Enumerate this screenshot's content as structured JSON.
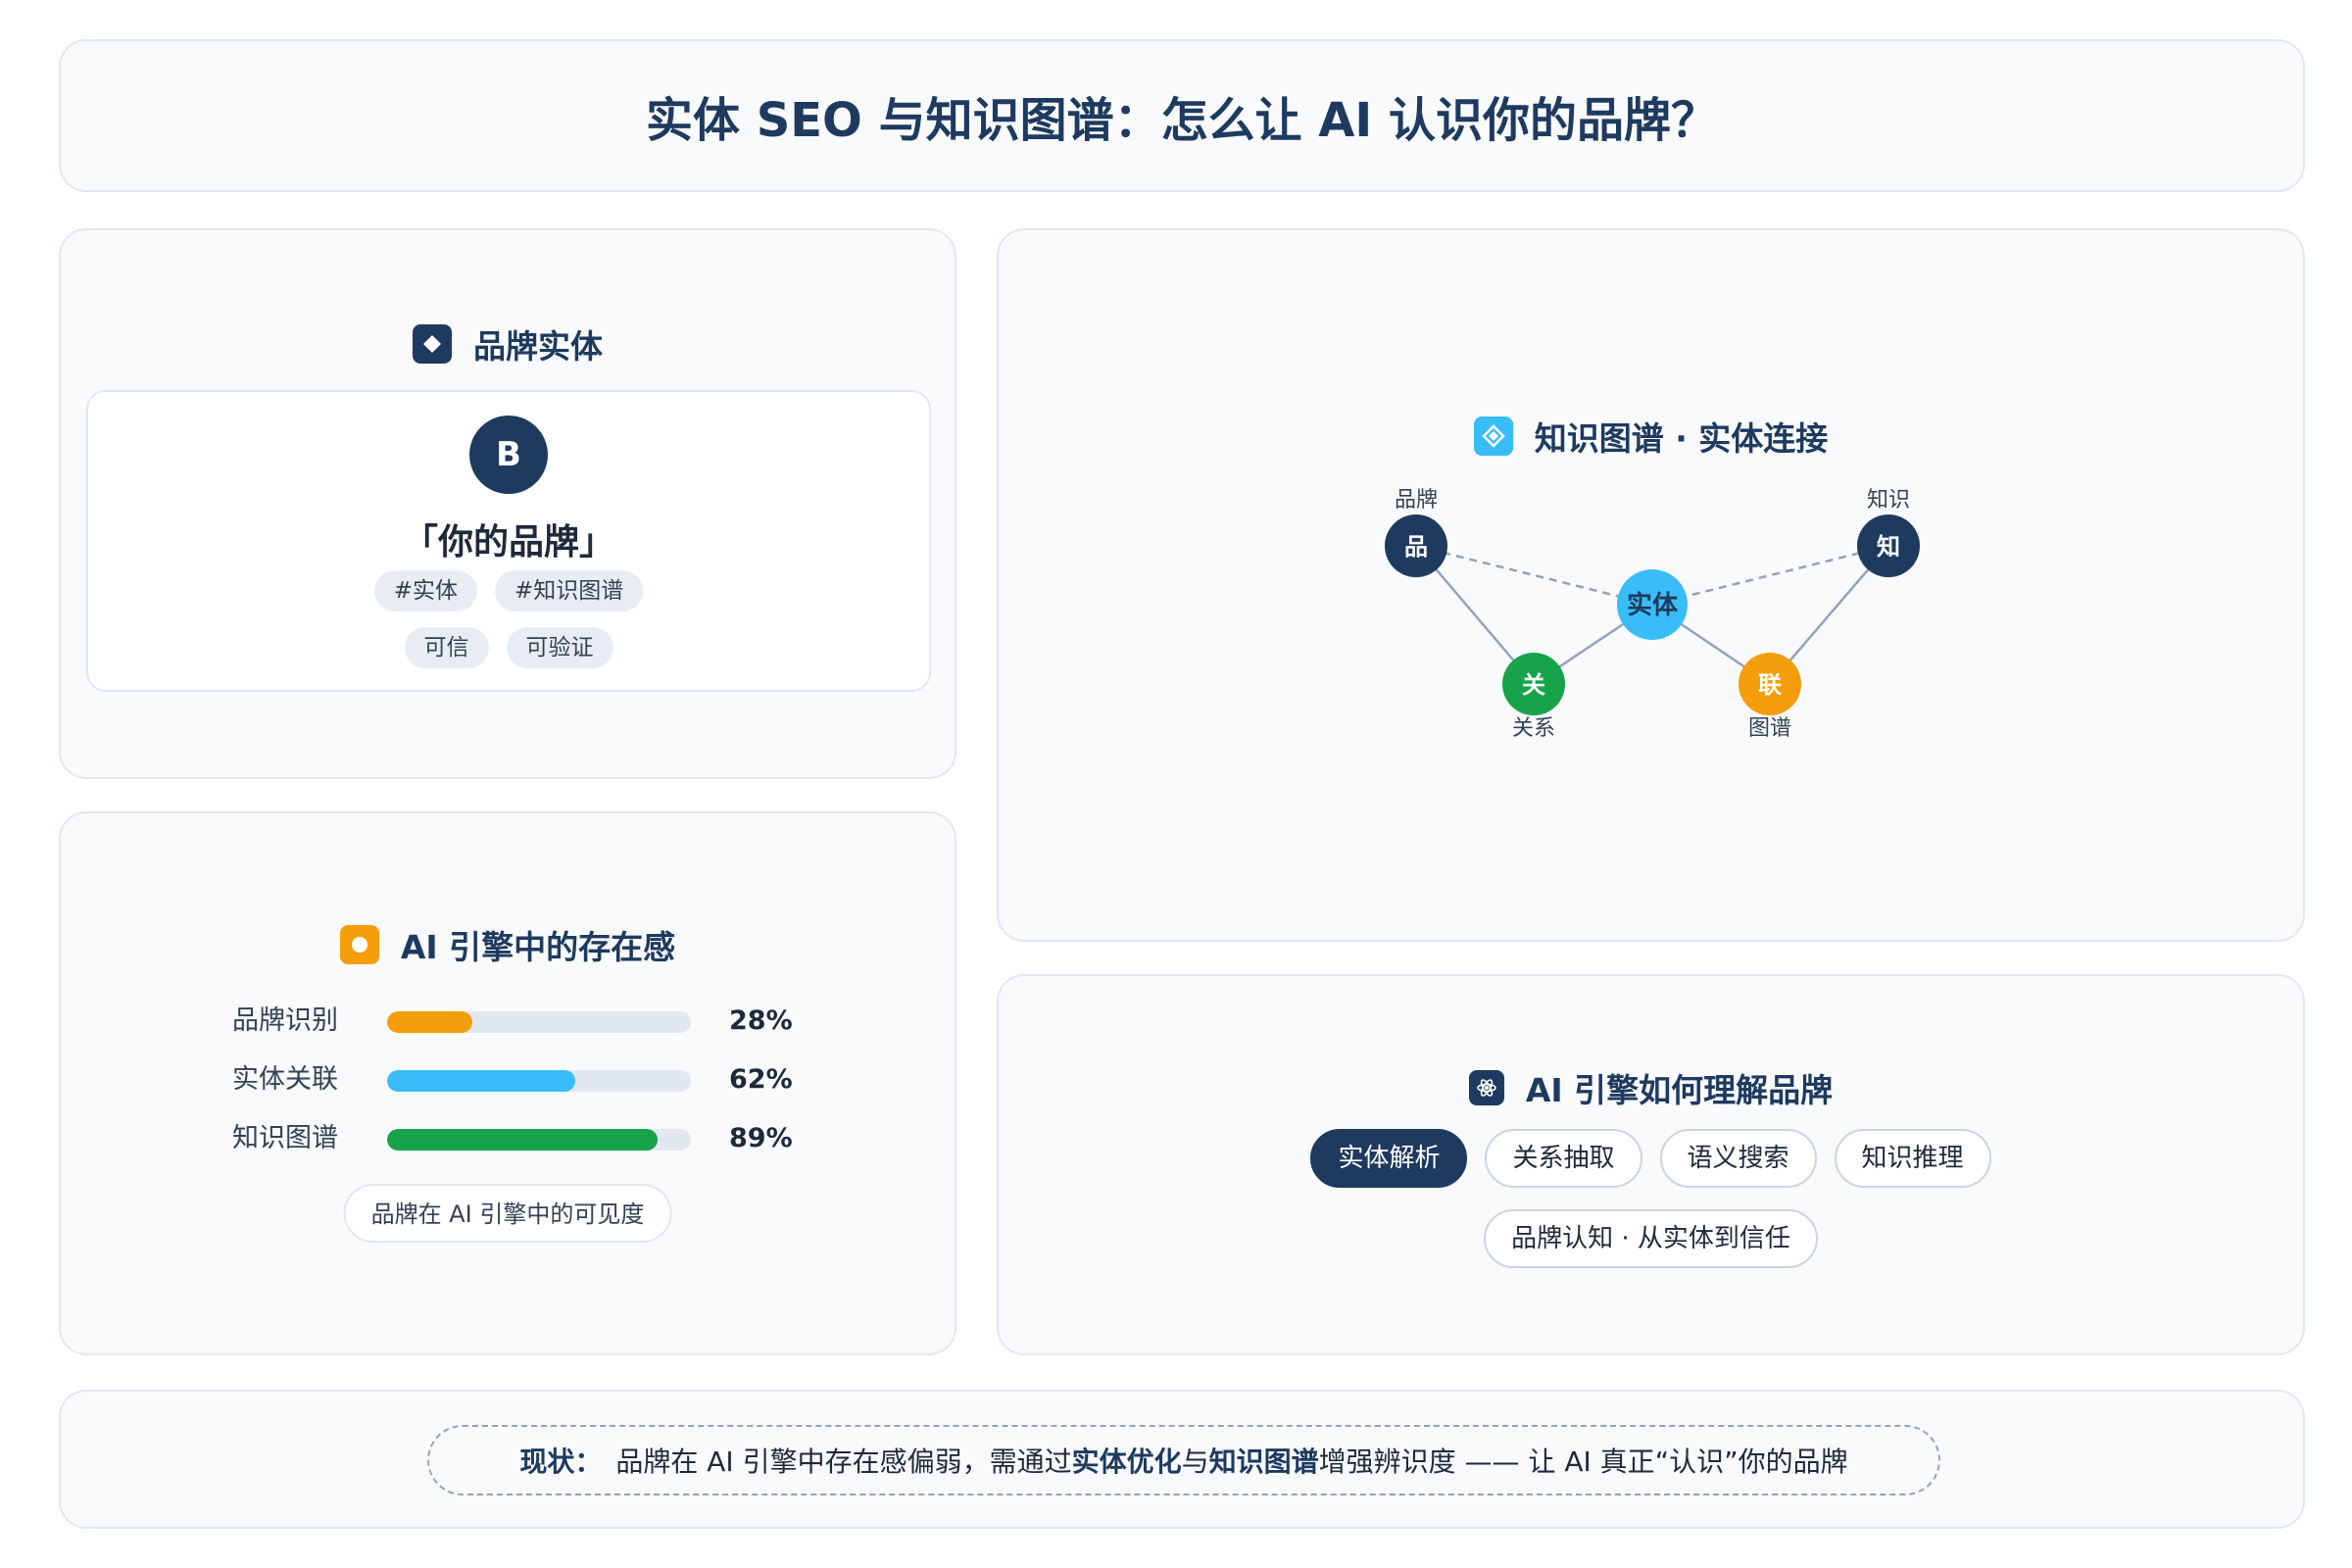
{
  "title": "实体 SEO 与知识图谱：怎么让 AI 认识你的品牌？",
  "colors": {
    "navy": "#1e3a5f",
    "sky": "#38bdf8",
    "green": "#16a34a",
    "orange": "#f59e0b"
  },
  "brand_card": {
    "heading": "品牌实体",
    "icon": "diamond-icon",
    "avatar_letter": "B",
    "name": "「你的品牌」",
    "tags_row1": [
      "#实体",
      "#知识图谱"
    ],
    "tags_row2": [
      "可信",
      "可验证"
    ]
  },
  "graph_card": {
    "heading": "知识图谱 · 实体连接",
    "icon": "diamond-outline-icon",
    "nodes": [
      {
        "id": "brand",
        "glyph": "品",
        "label": "品牌",
        "color": "#1e3a5f"
      },
      {
        "id": "knowledge",
        "glyph": "知",
        "label": "知识",
        "color": "#1e3a5f"
      },
      {
        "id": "entity",
        "glyph": "实体",
        "label": "",
        "color": "#38bdf8"
      },
      {
        "id": "relation",
        "glyph": "关",
        "label": "关系",
        "color": "#16a34a"
      },
      {
        "id": "link",
        "glyph": "联",
        "label": "图谱",
        "color": "#f59e0b"
      }
    ]
  },
  "presence_card": {
    "heading": "AI 引擎中的存在感",
    "icon": "circle-icon",
    "bars": [
      {
        "label": "品牌识别",
        "value": 28,
        "display": "28%",
        "color": "#f59e0b"
      },
      {
        "label": "实体关联",
        "value": 62,
        "display": "62%",
        "color": "#38bdf8"
      },
      {
        "label": "知识图谱",
        "value": 89,
        "display": "89%",
        "color": "#16a34a"
      }
    ],
    "note": "品牌在 AI 引擎中的可见度"
  },
  "engine_card": {
    "heading": "AI 引擎如何理解品牌",
    "icon": "atom-icon",
    "chips": [
      "实体解析",
      "关系抽取",
      "语义搜索",
      "知识推理"
    ],
    "summary": "品牌认知 · 从实体到信任"
  },
  "footer": {
    "lead": "现状：",
    "part1": "品牌在 AI 引擎中存在感偏弱，需通过",
    "em1": "实体优化",
    "part2": "与",
    "em2": "知识图谱",
    "part3": "增强辨识度 —— 让 AI 真正“认识”你的品牌"
  }
}
